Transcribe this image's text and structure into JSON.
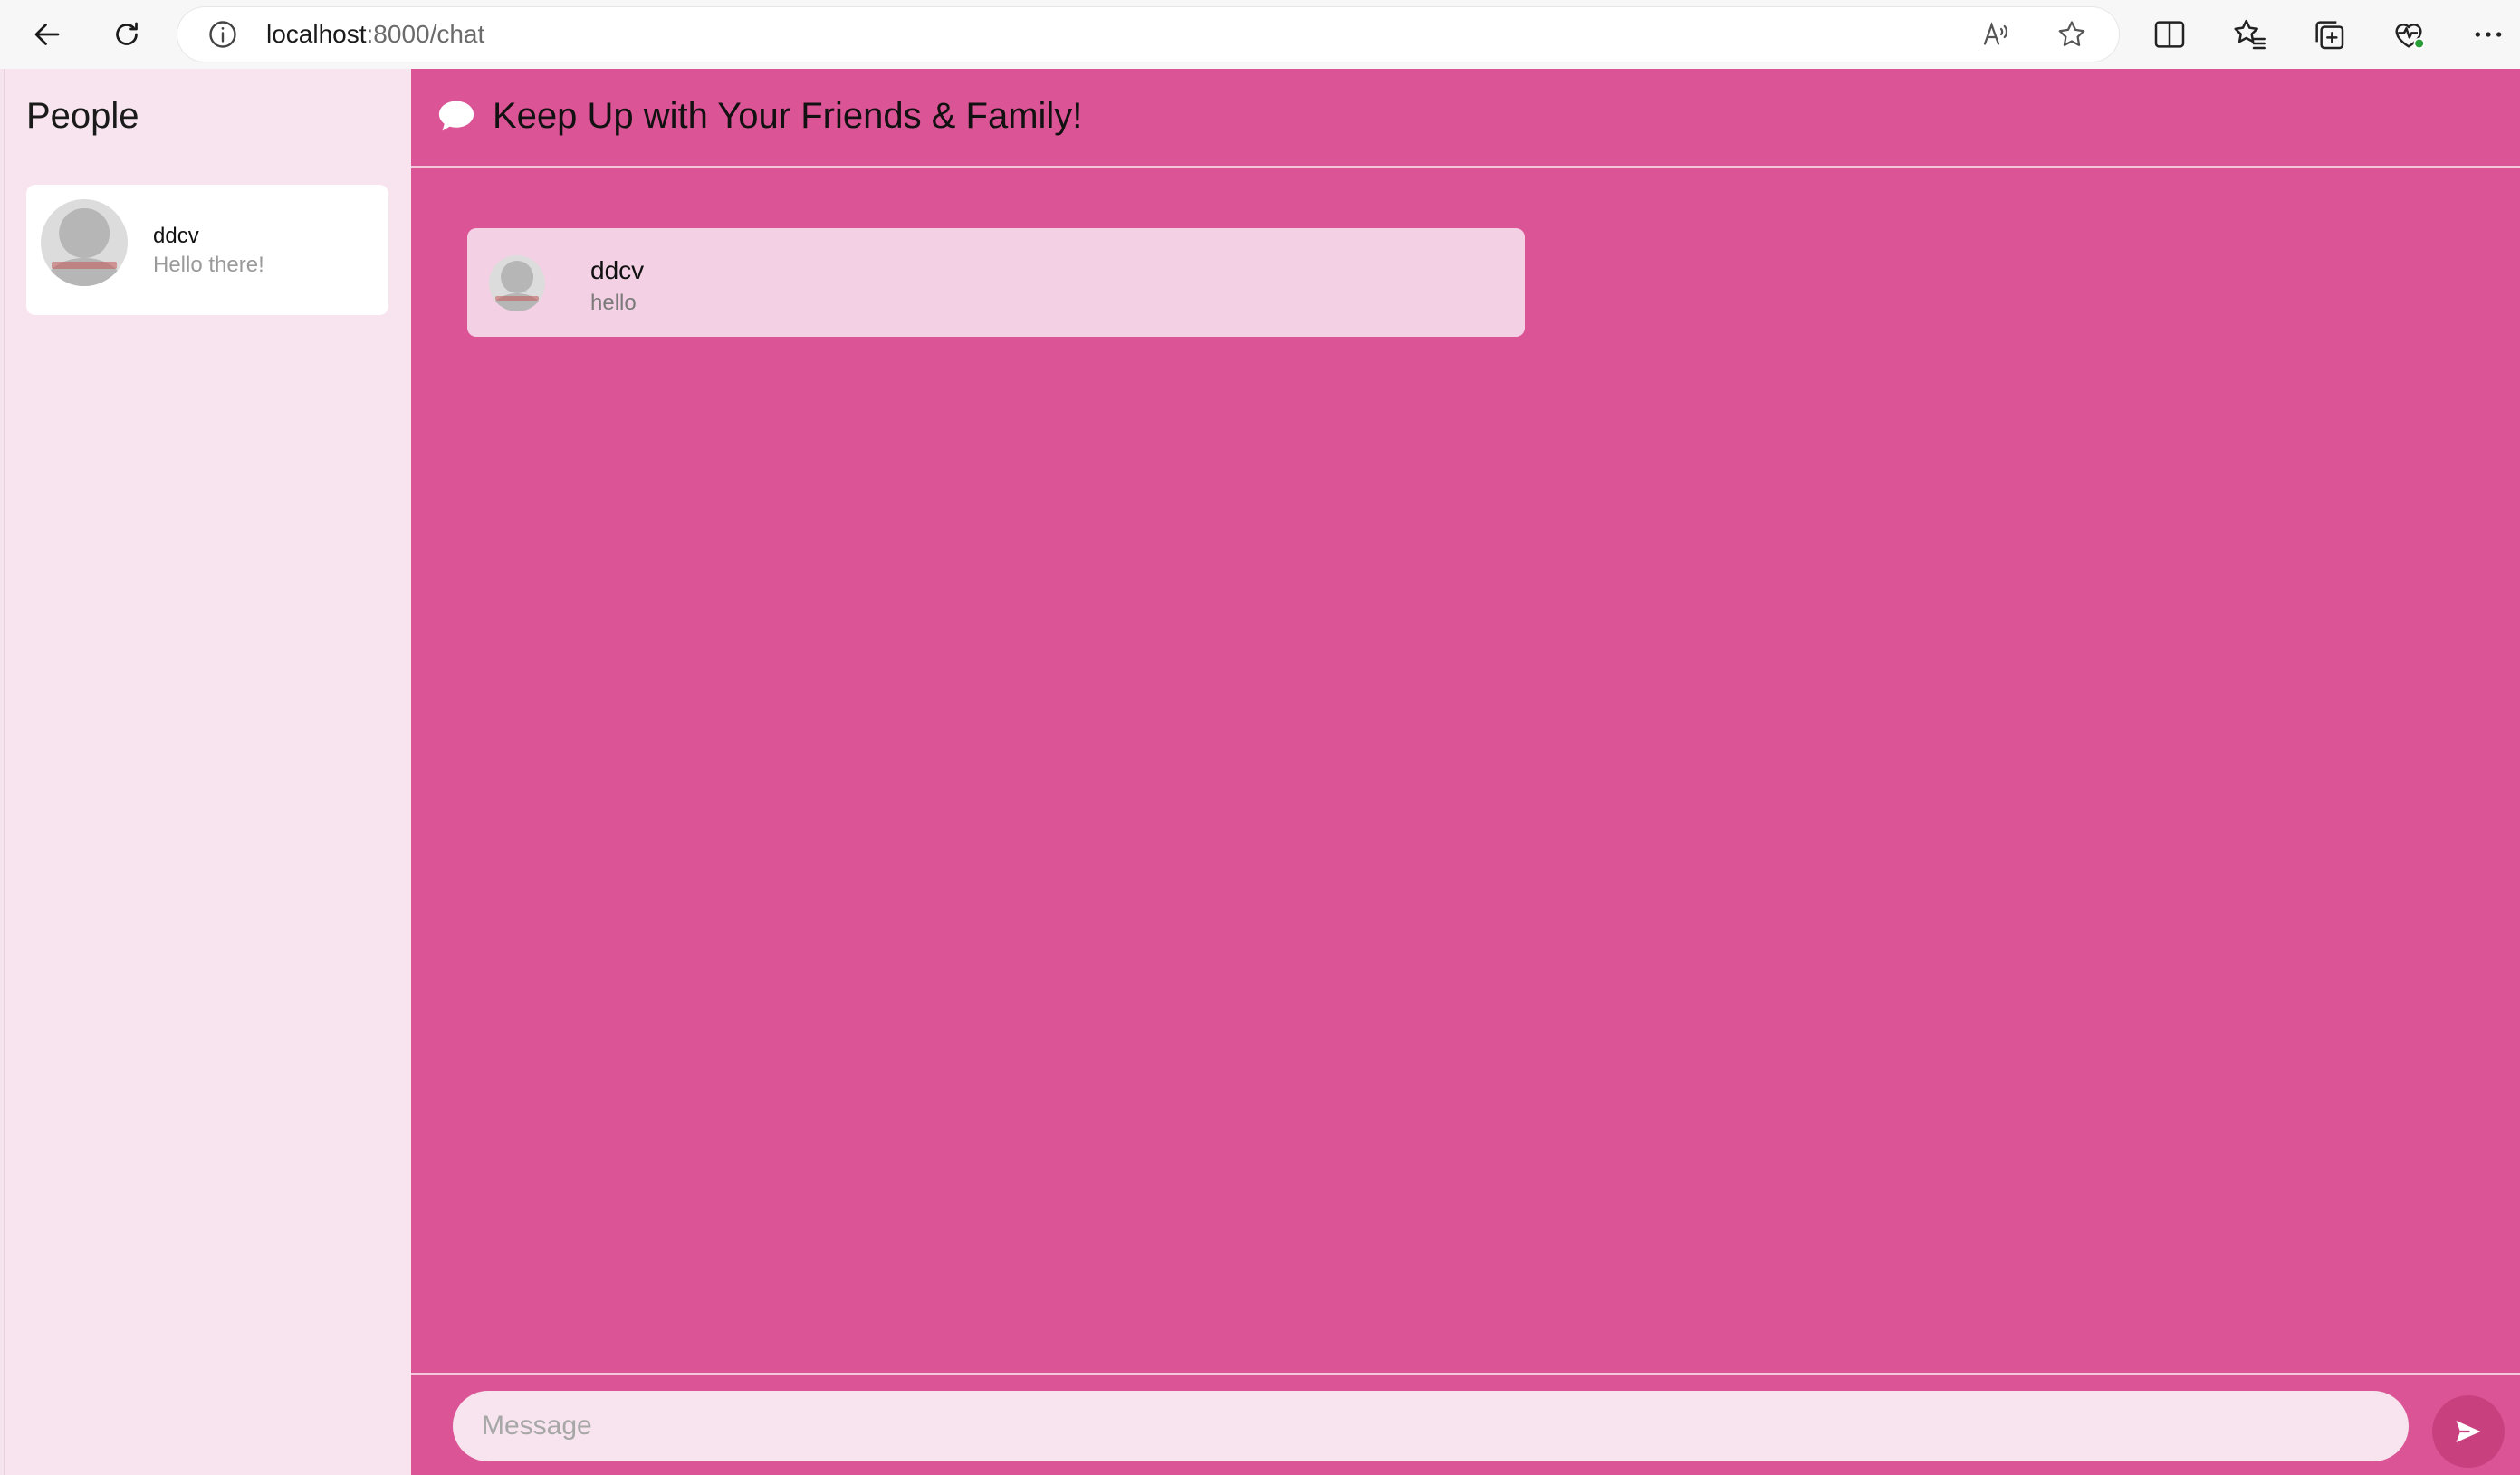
{
  "browser": {
    "url_host": "localhost",
    "url_path": ":8000/chat"
  },
  "sidebar": {
    "title": "People",
    "contacts": [
      {
        "name": "ddcv",
        "preview": "Hello there!"
      }
    ]
  },
  "chat": {
    "title": "Keep Up with Your Friends & Family!",
    "messages": [
      {
        "sender": "ddcv",
        "text": "hello"
      }
    ],
    "input_placeholder": "Message"
  },
  "colors": {
    "chat_background": "#db5596",
    "sidebar_background": "#f7e4ee",
    "message_card": "#f3d0e3",
    "send_button": "#c9407f"
  }
}
